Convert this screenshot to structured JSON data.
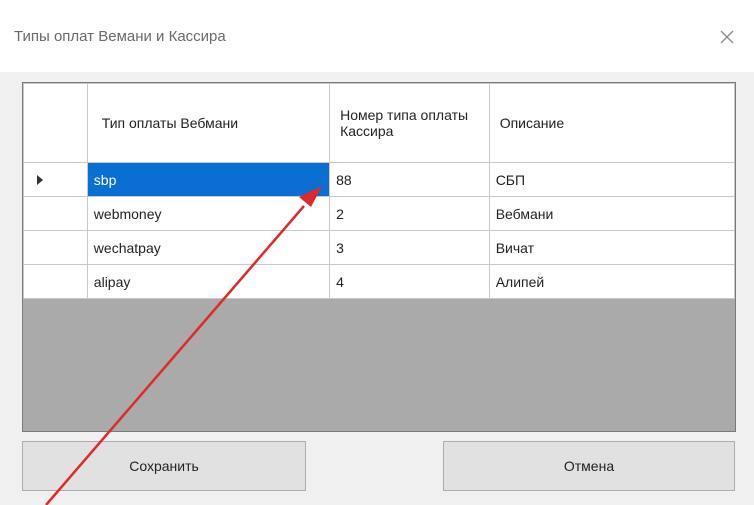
{
  "window": {
    "title": "Типы оплат Вемани и Кассира",
    "close_icon": "close-icon"
  },
  "grid": {
    "columns": [
      "Тип оплаты Вебмани",
      "Номер типа оплаты Кассира",
      "Описание"
    ],
    "rows": [
      {
        "type": "sbp",
        "number": "88",
        "description": "СБП",
        "current": true
      },
      {
        "type": "webmoney",
        "number": "2",
        "description": "Вебмани",
        "current": false
      },
      {
        "type": "wechatpay",
        "number": "3",
        "description": "Вичат",
        "current": false
      },
      {
        "type": "alipay",
        "number": "4",
        "description": "Алипей",
        "current": false
      }
    ],
    "selected_cell": "row 1, column 1",
    "selection_color": "#0a6fd3",
    "empty_area_color": "#aaaaaa"
  },
  "buttons": {
    "save_label": "Сохранить",
    "cancel_label": "Отмена"
  },
  "annotation": {
    "type": "arrow",
    "color": "#e02a2a",
    "points_to": "grid.rows.0.number"
  }
}
